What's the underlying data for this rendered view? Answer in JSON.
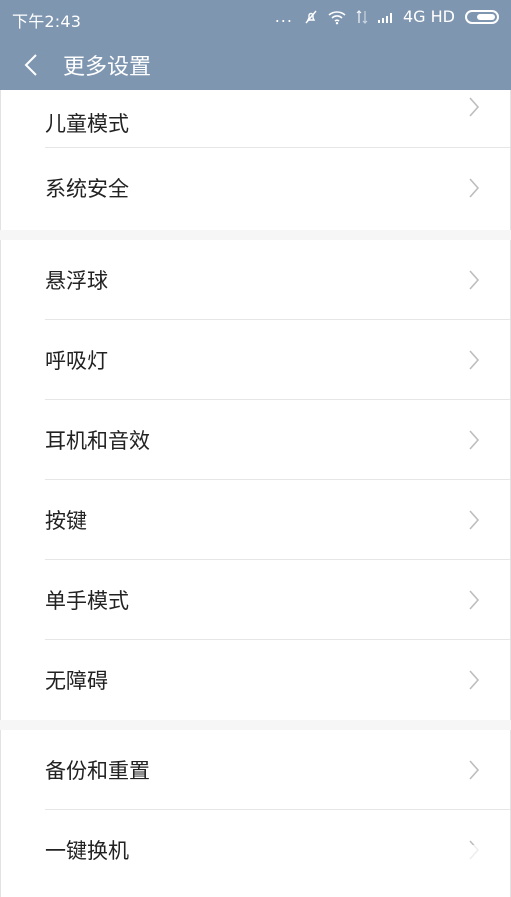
{
  "status_bar": {
    "time": "下午2:43",
    "dots": "...",
    "network": "4G HD"
  },
  "header": {
    "title": "更多设置"
  },
  "groups": [
    {
      "items": [
        {
          "label": "儿童模式"
        },
        {
          "label": "系统安全"
        }
      ]
    },
    {
      "items": [
        {
          "label": "悬浮球"
        },
        {
          "label": "呼吸灯"
        },
        {
          "label": "耳机和音效"
        },
        {
          "label": "按键"
        },
        {
          "label": "单手模式"
        },
        {
          "label": "无障碍"
        }
      ]
    },
    {
      "items": [
        {
          "label": "备份和重置"
        },
        {
          "label": "一键换机"
        }
      ]
    }
  ],
  "colors": {
    "header_bg": "#7f96b1",
    "section_bg": "#f6f6f6",
    "item_text": "#222222",
    "divider": "#e6e6e6"
  }
}
